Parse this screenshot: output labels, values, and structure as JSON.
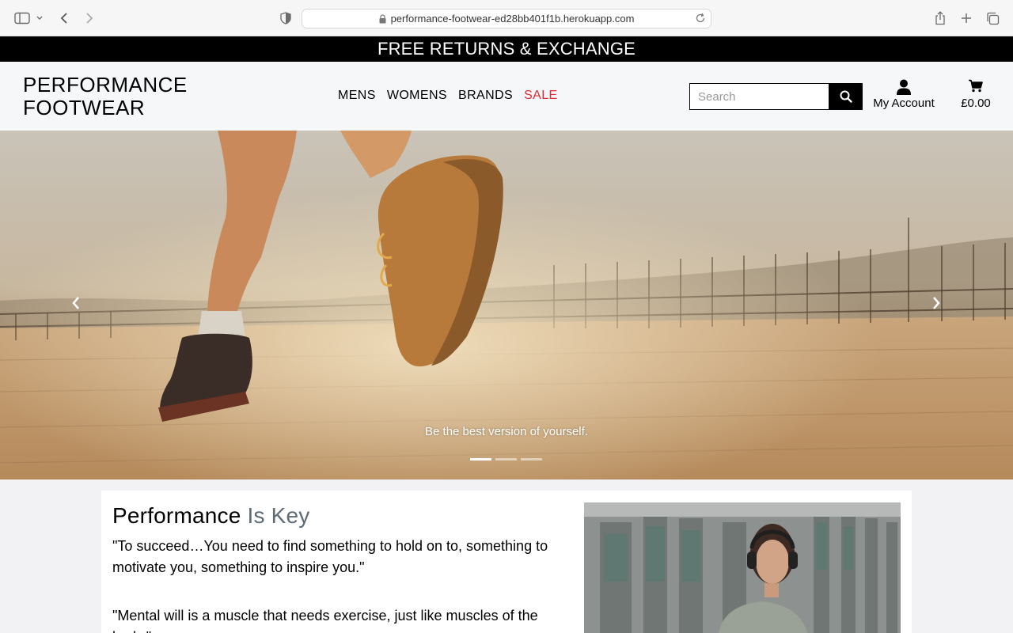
{
  "browser": {
    "url": "performance-footwear-ed28bb401f1b.herokuapp.com",
    "icons": [
      "sidebar-icon",
      "chevron-down-icon",
      "back-icon",
      "forward-icon",
      "shield-icon",
      "lock-icon",
      "reload-icon",
      "share-icon",
      "new-tab-icon",
      "tabs-icon"
    ]
  },
  "promo": {
    "text": "FREE RETURNS & EXCHANGE"
  },
  "header": {
    "logo_line1": "PERFORMANCE",
    "logo_line2": "FOOTWEAR",
    "nav": [
      {
        "label": "MENS"
      },
      {
        "label": "WOMENS"
      },
      {
        "label": "BRANDS"
      },
      {
        "label": "SALE"
      }
    ],
    "sale_color": "#e02b35",
    "search_placeholder": "Search",
    "account_label": "My Account",
    "cart_total": "£0.00"
  },
  "hero": {
    "caption": "Be the best version of yourself.",
    "slide_count": 3,
    "active_slide": 1
  },
  "intro": {
    "heading_main": "Performance",
    "heading_accent": "Is Key",
    "accent_color": "#5f6b74",
    "quote1": "\"To succeed…You need to find something to hold on to, something to motivate you, something to inspire you.\"",
    "quote2": "\"Mental will is a muscle that needs exercise, just like muscles of the body.\""
  }
}
